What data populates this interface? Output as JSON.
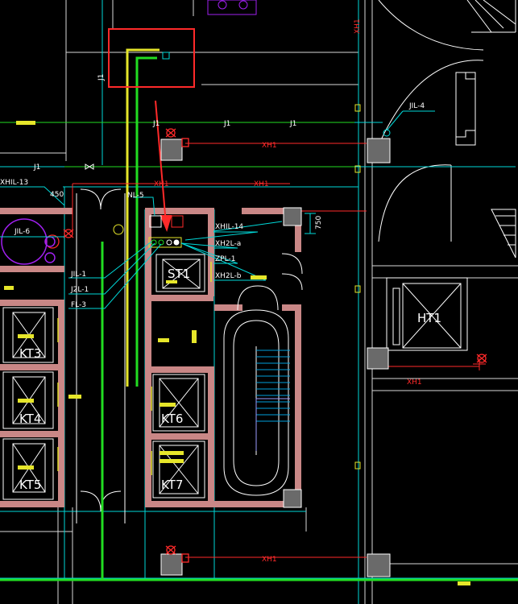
{
  "colors": {
    "background": "#000000",
    "wall_fill": "#c98786",
    "cyan_line": "#00d8d8",
    "green_pipe": "#22dd22",
    "yellow_pipe": "#e6e62a",
    "red_line": "#ff2a2a",
    "label_white": "#ffffff",
    "highlight_box": "#ff2a2a"
  },
  "pipe_labels": {
    "j1": "J1",
    "xh1": "XH1"
  },
  "callouts": {
    "xhil_13": "XHIL-13",
    "dim_450": "450",
    "jil_6": "JIL-6",
    "nl_5": "NL-5",
    "jil_1": "JIL-1",
    "j2l_1": "J2L-1",
    "fl_3": "FL-3",
    "xhil_14": "XHIL-14",
    "xh2l_a": "XH2L-a",
    "zpl_1": "ZPL-1",
    "xh2l_b": "XH2L-b",
    "jil_4": "JIL-4",
    "dim_750": "750"
  },
  "shafts": {
    "st1": "ST1",
    "kt3": "KT3",
    "kt4": "KT4",
    "kt5": "KT5",
    "kt6": "KT6",
    "kt7": "KT7",
    "ht1": "HT1"
  }
}
